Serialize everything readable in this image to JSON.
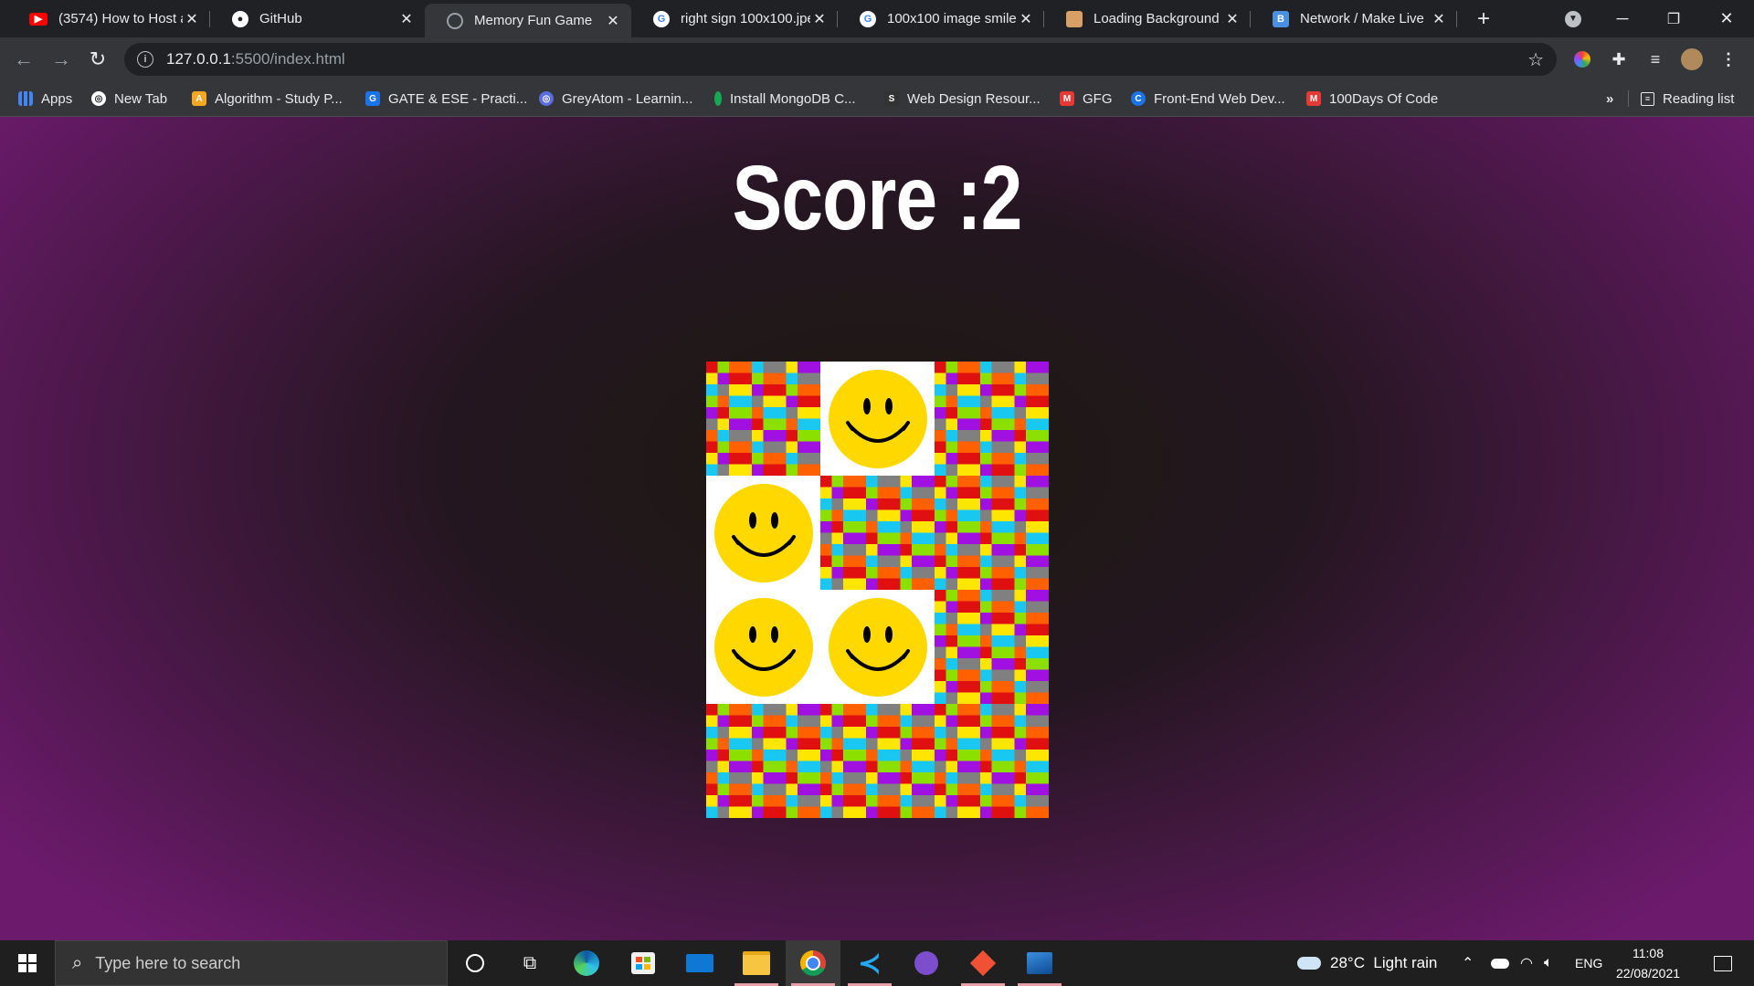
{
  "tabs": [
    {
      "title": "(3574) How to Host a",
      "icon": "youtube-icon",
      "color": "#ff0000",
      "active": false
    },
    {
      "title": "GitHub",
      "icon": "github-icon",
      "color": "#ffffff",
      "active": false
    },
    {
      "title": "Memory Fun Game",
      "icon": "globe-icon",
      "color": "#9aa0a6",
      "active": true
    },
    {
      "title": "right sign 100x100.jpe",
      "icon": "google-icon",
      "color": "#ffffff",
      "active": false
    },
    {
      "title": "100x100 image smile",
      "icon": "google-icon",
      "color": "#ffffff",
      "active": false
    },
    {
      "title": "Loading Background /",
      "icon": "image-icon",
      "color": "#d9a066",
      "active": false
    },
    {
      "title": "Network / Make Live",
      "icon": "bootstrap-icon",
      "color": "#4a90e2",
      "active": false
    }
  ],
  "toolbar": {
    "url_host": "127.0.0.1",
    "url_rest": ":5500/index.html"
  },
  "bookmarks": [
    {
      "label": "Apps",
      "icon": "apps-grid-icon",
      "color": "#4285f4"
    },
    {
      "label": "New Tab",
      "icon": "globe-icon",
      "color": "#ffffff"
    },
    {
      "label": "Algorithm - Study P...",
      "icon": "algorithm-icon",
      "color": "#f5a623"
    },
    {
      "label": "GATE & ESE - Practi...",
      "icon": "gate-icon",
      "color": "#1a73e8"
    },
    {
      "label": "GreyAtom - Learnin...",
      "icon": "greyatom-icon",
      "color": "#5b6ee1"
    },
    {
      "label": "Install MongoDB C...",
      "icon": "mongodb-icon",
      "color": "#13aa52"
    },
    {
      "label": "Web Design Resour...",
      "icon": "webdesign-icon",
      "color": "#333333"
    },
    {
      "label": "GFG",
      "icon": "gfg-icon",
      "color": "#e53935"
    },
    {
      "label": "Front-End Web Dev...",
      "icon": "codecademy-icon",
      "color": "#1a73e8"
    },
    {
      "label": "100Days Of Code",
      "icon": "gmail-icon",
      "color": "#e53935"
    },
    {
      "label": "Reading list",
      "icon": "reading-list-icon",
      "color": "#e8eaed"
    }
  ],
  "bookmarks_overflow": "»",
  "game": {
    "score_text": "Score :2",
    "cards": [
      "back",
      "front",
      "back",
      "front",
      "back",
      "back",
      "front",
      "front",
      "back",
      "back",
      "back",
      "back"
    ]
  },
  "taskbar": {
    "search_placeholder": "Type here to search",
    "weather": "28°C  Light rain",
    "language": "ENG",
    "time": "11:08",
    "date": "22/08/2021"
  }
}
